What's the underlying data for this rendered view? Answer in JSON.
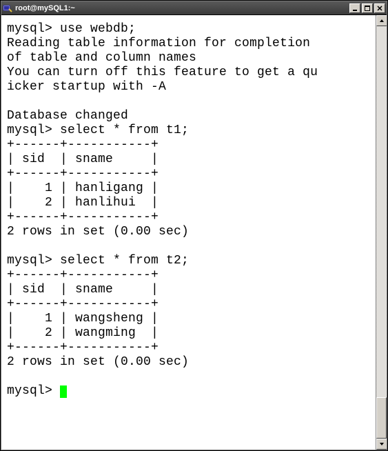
{
  "titlebar": {
    "title": "root@mySQL1:~"
  },
  "terminal": {
    "prompt": "mysql> ",
    "cmd_use": "use webdb;",
    "msg1": "Reading table information for completion",
    "msg2": "of table and column names",
    "msg3": "You can turn off this feature to get a qu",
    "msg4": "icker startup with -A",
    "blank": "",
    "db_changed": "Database changed",
    "cmd_select1": "select * from t1;",
    "cmd_select2": "select * from t2;",
    "border": "+------+-----------+",
    "header": "| sid  | sname     |",
    "t1_r1": "|    1 | hanligang |",
    "t1_r2": "|    2 | hanlihui  |",
    "t2_r1": "|    1 | wangsheng |",
    "t2_r2": "|    2 | wangming  |",
    "rows_msg": "2 rows in set (0.00 sec)"
  },
  "chart_data": {
    "type": "table",
    "tables": [
      {
        "name": "t1",
        "columns": [
          "sid",
          "sname"
        ],
        "rows": [
          [
            1,
            "hanligang"
          ],
          [
            2,
            "hanlihui"
          ]
        ],
        "row_count": 2,
        "elapsed_sec": 0.0
      },
      {
        "name": "t2",
        "columns": [
          "sid",
          "sname"
        ],
        "rows": [
          [
            1,
            "wangsheng"
          ],
          [
            2,
            "wangming"
          ]
        ],
        "row_count": 2,
        "elapsed_sec": 0.0
      }
    ]
  }
}
